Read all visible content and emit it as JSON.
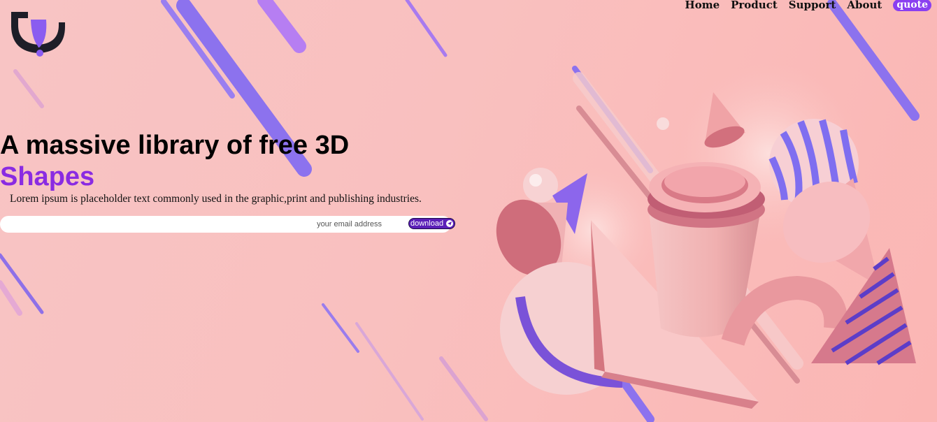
{
  "nav": {
    "items": [
      {
        "label": "Home"
      },
      {
        "label": "Product"
      },
      {
        "label": "Support"
      },
      {
        "label": "About"
      }
    ],
    "cta_label": "quote"
  },
  "hero": {
    "title": "A massive library of free 3D",
    "accent": "Shapes",
    "description": "Lorem ipsum is placeholder text commonly used in the graphic,print and publishing industries."
  },
  "signup": {
    "email_placeholder": "your email address",
    "email_value": "",
    "button_label": "download",
    "button_icon": "send-icon"
  },
  "colors": {
    "background": "#f9c0bf",
    "accent": "#8a2be2",
    "stripe": "#8c70f0",
    "button": "#5b1fb8"
  }
}
